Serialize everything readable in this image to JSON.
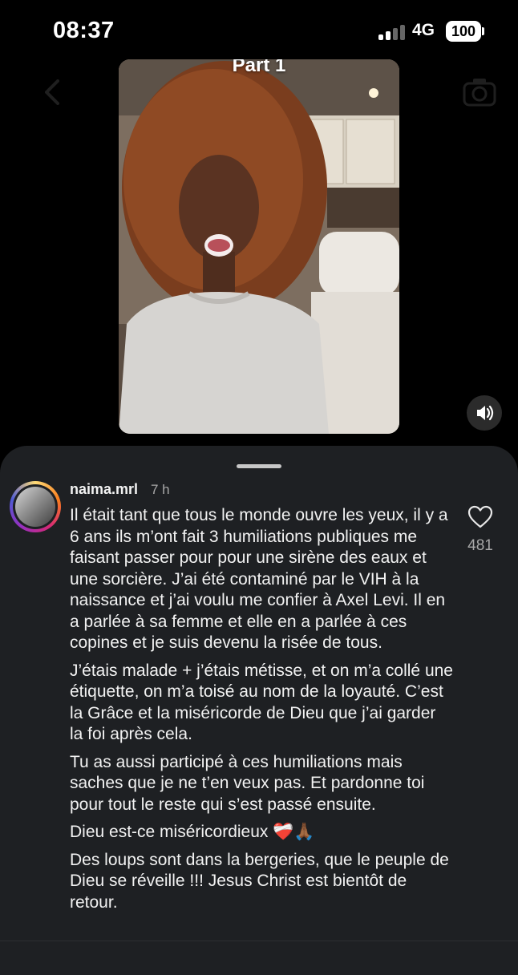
{
  "status_bar": {
    "time": "08:37",
    "network": "4G",
    "battery": "100"
  },
  "video": {
    "overlay_title": "Part 1"
  },
  "comment": {
    "username": "naima.mrl",
    "time_ago": "7 h",
    "likes": "481",
    "paragraphs": [
      "Il était tant que tous le monde ouvre les yeux, il y a 6 ans ils m’ont fait 3 humiliations publiques me faisant passer pour pour une sirène des eaux et une sorcière. J’ai été contaminé par le VIH à la naissance et j’ai voulu me confier à Axel Levi. Il en a parlée à sa femme et elle en a parlée à ces copines et je suis devenu la risée de tous.",
      "J’étais malade + j’étais métisse, et on m’a collé une étiquette, on m’a toisé au nom de la loyauté. C’est la Grâce et la miséricorde de Dieu que j’ai garder la foi après cela.",
      "Tu as aussi participé à ces humiliations mais saches que je ne t’en veux pas. Et pardonne toi pour tout le reste qui s’est passé ensuite.",
      "Dieu est-ce miséricordieux ❤️‍🩹🙏🏾",
      "Des loups sont dans la bergeries, que le peuple de Dieu se réveille !!! Jesus Christ est bientôt de retour."
    ]
  },
  "colors": {
    "sheet": "#1e2023",
    "secondary_text": "#a8a8a8"
  }
}
